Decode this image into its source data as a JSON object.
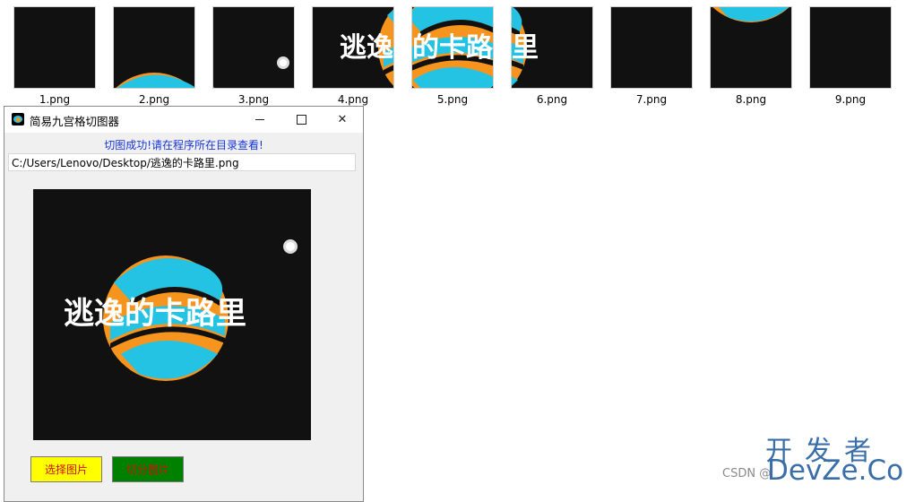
{
  "thumbnails": [
    {
      "label": "1.png"
    },
    {
      "label": "2.png"
    },
    {
      "label": "3.png"
    },
    {
      "label": "4.png"
    },
    {
      "label": "5.png"
    },
    {
      "label": "6.png"
    },
    {
      "label": "7.png"
    },
    {
      "label": "8.png"
    },
    {
      "label": "9.png"
    }
  ],
  "window": {
    "title": "简易九宫格切图器",
    "app_icon": "app-icon",
    "minimize_icon": "minimize-icon",
    "maximize_icon": "maximize-icon",
    "close_icon": "close-icon"
  },
  "status_text": "切图成功!请在程序所在目录查看!",
  "path_value": "C:/Users/Lenovo/Desktop/逃逸的卡路里.png",
  "preview_logo_text": "逃逸的卡路里",
  "buttons": {
    "select_label": "选择图片",
    "cut_label": "切分图片"
  },
  "watermark": {
    "top": "开发者",
    "csdn": "CSDN @",
    "bottom": "DevZe.CoM"
  },
  "colors": {
    "image_background": "#111111",
    "logo_blue": "#24c3e4",
    "logo_orange": "#f7941d",
    "status_text": "#1535d8",
    "select_button": "#ffff00",
    "cut_button": "#008000",
    "button_text": "#d01010"
  }
}
